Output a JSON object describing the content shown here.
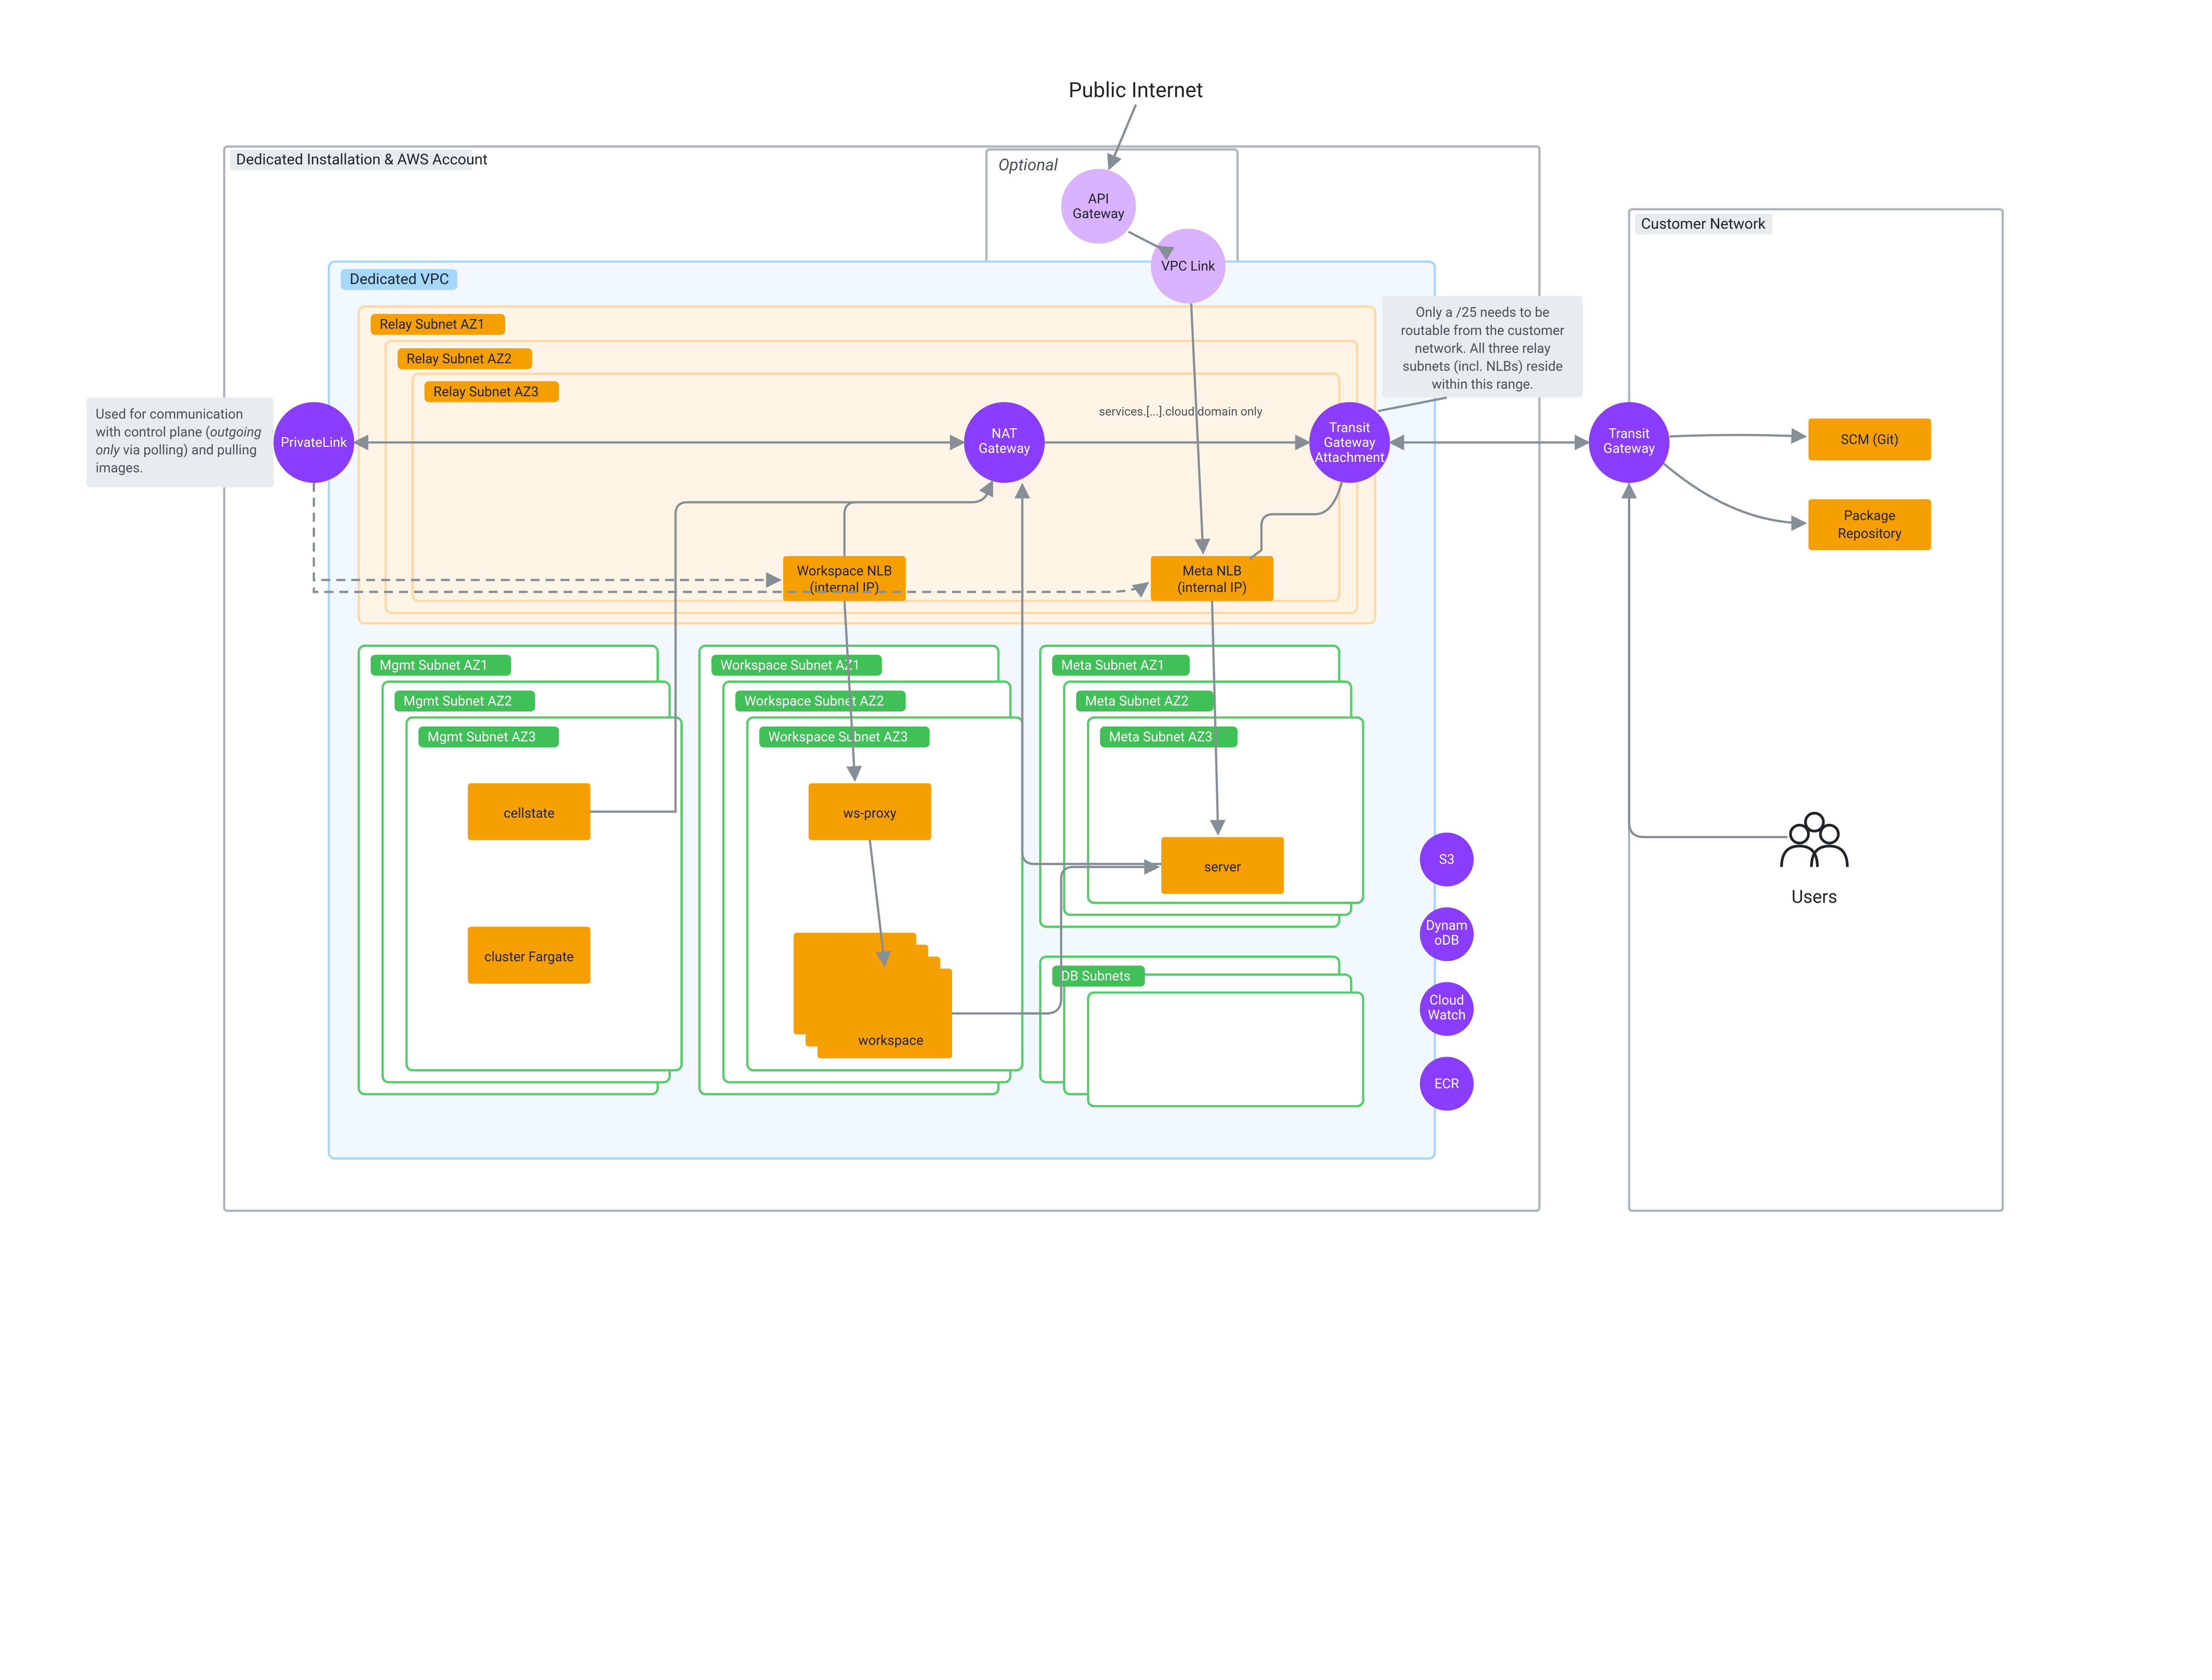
{
  "headings": {
    "public_internet": "Public Internet",
    "users": "Users"
  },
  "regions": {
    "aws_account": "Dedicated Installation & AWS Account",
    "optional": "Optional",
    "customer_network": "Customer Network",
    "vpc": "Dedicated VPC"
  },
  "relay_subnets": {
    "az1": "Relay Subnet AZ1",
    "az2": "Relay Subnet AZ2",
    "az3": "Relay Subnet AZ3"
  },
  "mgmt_subnets": {
    "az1": "Mgmt Subnet AZ1",
    "az2": "Mgmt Subnet AZ2",
    "az3": "Mgmt Subnet AZ3"
  },
  "ws_subnets": {
    "az1": "Workspace Subnet AZ1",
    "az2": "Workspace Subnet AZ2",
    "az3": "Workspace Subnet AZ3"
  },
  "meta_subnets": {
    "az1": "Meta Subnet AZ1",
    "az2": "Meta Subnet AZ2",
    "az3": "Meta Subnet AZ3"
  },
  "db_subnets": "DB Subnets",
  "circles": {
    "api_gateway_l1": "API",
    "api_gateway_l2": "Gateway",
    "vpc_link": "VPC Link",
    "privatelink": "PrivateLink",
    "nat_l1": "NAT",
    "nat_l2": "Gateway",
    "tgw_attach_l1": "Transit",
    "tgw_attach_l2": "Gateway",
    "tgw_attach_l3": "Attachment",
    "tgw_l1": "Transit",
    "tgw_l2": "Gateway",
    "s3": "S3",
    "dynamodb_l1": "Dynam",
    "dynamodb_l2": "oDB",
    "cloudwatch_l1": "Cloud",
    "cloudwatch_l2": "Watch",
    "ecr": "ECR"
  },
  "boxes": {
    "workspace_nlb_l1": "Workspace NLB",
    "workspace_nlb_l2": "(internal IP)",
    "meta_nlb_l1": "Meta NLB",
    "meta_nlb_l2": "(internal IP)",
    "cellstate": "cellstate",
    "cluster_fargate": "cluster Fargate",
    "ws_proxy": "ws-proxy",
    "workspace": "workspace",
    "server": "server",
    "scm": "SCM (Git)",
    "pkg_repo_l1": "Package",
    "pkg_repo_l2": "Repository"
  },
  "notes": {
    "privatelink_l1": "Used for communication",
    "privatelink_l2": "with control plane (",
    "privatelink_l2_i": "outgoing",
    "privatelink_l3_i": "only",
    "privatelink_l3": " via polling) and pulling",
    "privatelink_l4": "images.",
    "routable_l1": "Only a /25 needs to be",
    "routable_l2": "routable from the customer",
    "routable_l3": "network. All three relay",
    "routable_l4": "subnets (incl. NLBs) reside",
    "routable_l5": "within this range."
  },
  "edge_label": "services.[...].cloud domain only"
}
